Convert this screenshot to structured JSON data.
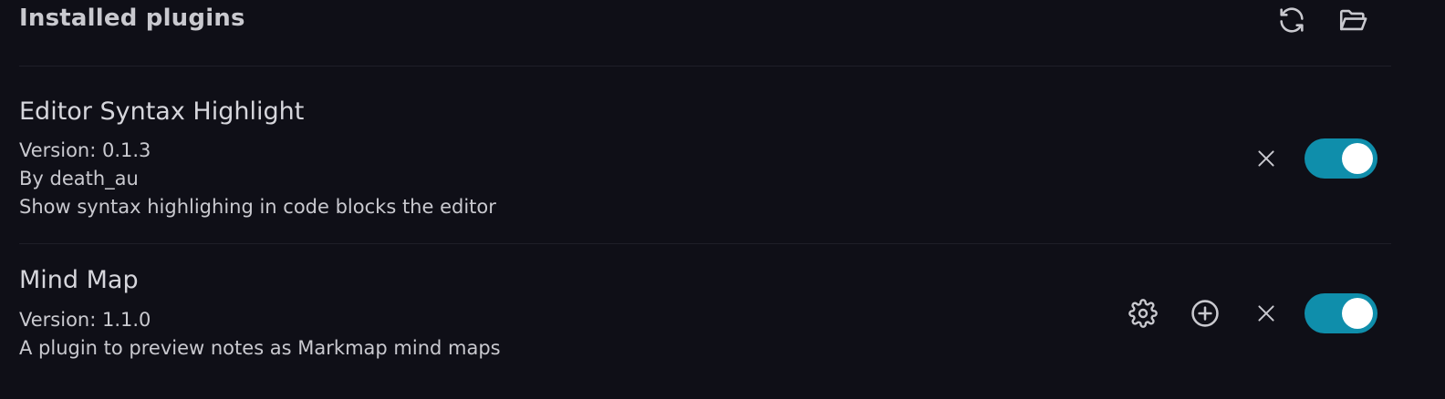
{
  "header": {
    "title": "Installed plugins",
    "reload_icon": "refresh-icon",
    "folder_icon": "open-folder-icon"
  },
  "plugins": [
    {
      "name": "Editor Syntax Highlight",
      "version": "Version: 0.1.3",
      "author": "By death_au",
      "description": "Show syntax highlighing in code blocks the editor",
      "enabled": true,
      "actions": [
        "close-icon"
      ]
    },
    {
      "name": "Mind Map",
      "version": "Version: 1.1.0",
      "description": "A plugin to preview notes as Markmap mind maps",
      "enabled": true,
      "actions": [
        "gear-icon",
        "plus-circle-icon",
        "close-icon"
      ]
    }
  ],
  "colors": {
    "background": "#0f0f17",
    "toggle_on": "#0f8eab",
    "text": "#d6d6dc"
  }
}
